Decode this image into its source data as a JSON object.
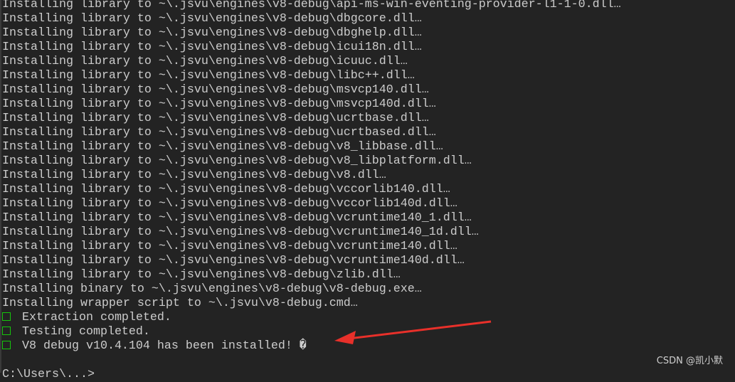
{
  "terminal": {
    "lines": [
      "Installing library to ~\\.jsvu\\engines\\v8-debug\\api-ms-win-eventing-provider-l1-1-0.dll…",
      "Installing library to ~\\.jsvu\\engines\\v8-debug\\dbgcore.dll…",
      "Installing library to ~\\.jsvu\\engines\\v8-debug\\dbghelp.dll…",
      "Installing library to ~\\.jsvu\\engines\\v8-debug\\icui18n.dll…",
      "Installing library to ~\\.jsvu\\engines\\v8-debug\\icuuc.dll…",
      "Installing library to ~\\.jsvu\\engines\\v8-debug\\libc++.dll…",
      "Installing library to ~\\.jsvu\\engines\\v8-debug\\msvcp140.dll…",
      "Installing library to ~\\.jsvu\\engines\\v8-debug\\msvcp140d.dll…",
      "Installing library to ~\\.jsvu\\engines\\v8-debug\\ucrtbase.dll…",
      "Installing library to ~\\.jsvu\\engines\\v8-debug\\ucrtbased.dll…",
      "Installing library to ~\\.jsvu\\engines\\v8-debug\\v8_libbase.dll…",
      "Installing library to ~\\.jsvu\\engines\\v8-debug\\v8_libplatform.dll…",
      "Installing library to ~\\.jsvu\\engines\\v8-debug\\v8.dll…",
      "Installing library to ~\\.jsvu\\engines\\v8-debug\\vccorlib140.dll…",
      "Installing library to ~\\.jsvu\\engines\\v8-debug\\vccorlib140d.dll…",
      "Installing library to ~\\.jsvu\\engines\\v8-debug\\vcruntime140_1.dll…",
      "Installing library to ~\\.jsvu\\engines\\v8-debug\\vcruntime140_1d.dll…",
      "Installing library to ~\\.jsvu\\engines\\v8-debug\\vcruntime140.dll…",
      "Installing library to ~\\.jsvu\\engines\\v8-debug\\vcruntime140d.dll…",
      "Installing library to ~\\.jsvu\\engines\\v8-debug\\zlib.dll…",
      "Installing binary to ~\\.jsvu\\engines\\v8-debug\\v8-debug.exe…",
      "Installing wrapper script to ~\\.jsvu\\v8-debug.cmd…"
    ],
    "status_lines": [
      "Extraction completed.",
      "Testing completed.",
      "V8 debug v10.4.104 has been installed! �"
    ],
    "prompt": "C:\\Users\\...>"
  },
  "watermark": "CSDN @凯小默",
  "colors": {
    "background": "#232323",
    "text": "#cccccc",
    "check": "#16c60c",
    "arrow": "#e8302a"
  }
}
